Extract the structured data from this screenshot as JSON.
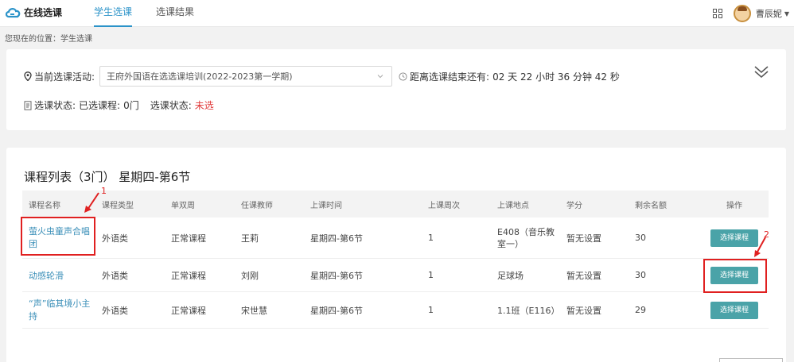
{
  "header": {
    "logo_text": "在线选课",
    "nav": [
      {
        "label": "学生选课",
        "active": true
      },
      {
        "label": "选课结果",
        "active": false
      }
    ],
    "user_name": "曹辰妮",
    "accent_color": "#2b93c9"
  },
  "breadcrumb": "您现在的位置：学生选课",
  "activity": {
    "label": "当前选课活动:",
    "selected": "王府外国语在选选课培训(2022-2023第一学期)",
    "countdown_label": "距离选课结束还有:",
    "countdown_value": "02 天 22 小时 36 分钟 42 秒"
  },
  "status": {
    "label": "选课状态:",
    "selected_label": "已选课程:",
    "selected_count": "0门",
    "state_label": "选课状态:",
    "state_value": "未选",
    "state_color": "#e03a3a"
  },
  "list": {
    "title": "课程列表（3门）  星期四-第6节",
    "columns": [
      "课程名称",
      "课程类型",
      "单双周",
      "任课教师",
      "上课时间",
      "上课周次",
      "上课地点",
      "学分",
      "剩余名额",
      "操作"
    ],
    "rows": [
      {
        "name": "萤火虫童声合唱团",
        "type": "外语类",
        "week": "正常课程",
        "teacher": "王莉",
        "time": "星期四-第6节",
        "weeks": "1",
        "location": "E408（音乐教室一）",
        "credit": "暂无设置",
        "remaining": "30",
        "action": "选择课程"
      },
      {
        "name": "动感轮滑",
        "type": "外语类",
        "week": "正常课程",
        "teacher": "刘刚",
        "time": "星期四-第6节",
        "weeks": "1",
        "location": "足球场",
        "credit": "暂无设置",
        "remaining": "30",
        "action": "选择课程"
      },
      {
        "name": "“声”临其境小主持",
        "type": "外语类",
        "week": "正常课程",
        "teacher": "宋世慧",
        "time": "星期四-第6节",
        "weeks": "1",
        "location": "1.1班（E116）",
        "credit": "暂无设置",
        "remaining": "29",
        "action": "选择课程"
      }
    ],
    "button_color": "#4aa3a8",
    "link_color": "#3b8fb8"
  },
  "annotations": {
    "marker_1": "1",
    "marker_2": "2",
    "color": "#e02020"
  }
}
